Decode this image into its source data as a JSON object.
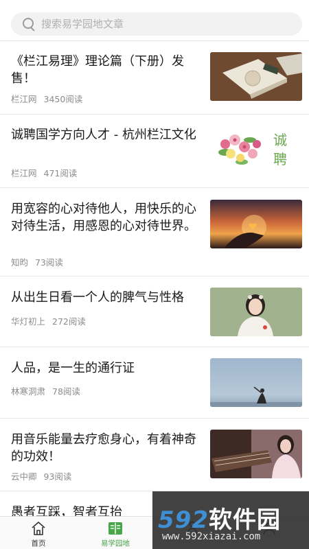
{
  "search": {
    "placeholder": "搜索易学园地文章"
  },
  "articles": [
    {
      "title": "《栏江易理》理论篇（下册）发售！",
      "author": "栏江网",
      "reads": "3450阅读",
      "thumb": "book-photo"
    },
    {
      "title": "诚聘国学方向人才 - 杭州栏江文化",
      "author": "栏江网",
      "reads": "471阅读",
      "thumb": "flowers-recruit-graphic",
      "thumb_text": "诚聘"
    },
    {
      "title": "用宽容的心对待他人，用快乐的心对待生活，用感恩的心对待世界。",
      "author": "知昀",
      "reads": "73阅读",
      "thumb": "heart-sunset-photo"
    },
    {
      "title": "从出生日看一个人的脾气与性格",
      "author": "华灯初上",
      "reads": "272阅读",
      "thumb": "girl-portrait-photo"
    },
    {
      "title": "人品，是一生的通行证",
      "author": "林寒洞肃",
      "reads": "78阅读",
      "thumb": "seaside-figure-photo"
    },
    {
      "title": "用音乐能量去疗愈身心，有着神奇的功效！",
      "author": "云中卿",
      "reads": "93阅读",
      "thumb": "guzheng-photo"
    },
    {
      "title": "愚者互踩，智者互抬",
      "author": "",
      "reads": "",
      "thumb": ""
    }
  ],
  "nav": {
    "items": [
      {
        "label": "首页",
        "icon": "home-icon",
        "active": false
      },
      {
        "label": "易学园地",
        "icon": "book-icon",
        "active": true
      },
      {
        "label": "",
        "icon": "figure-icon",
        "active": false
      },
      {
        "label": "",
        "icon": "user-icon",
        "active": false
      }
    ]
  },
  "watermark": {
    "brand_num": "592",
    "brand_cn": "软件园",
    "url": "www.592xiazai.com"
  },
  "colors": {
    "accent": "#49a54a",
    "watermark_blue": "#3f8fd4"
  }
}
